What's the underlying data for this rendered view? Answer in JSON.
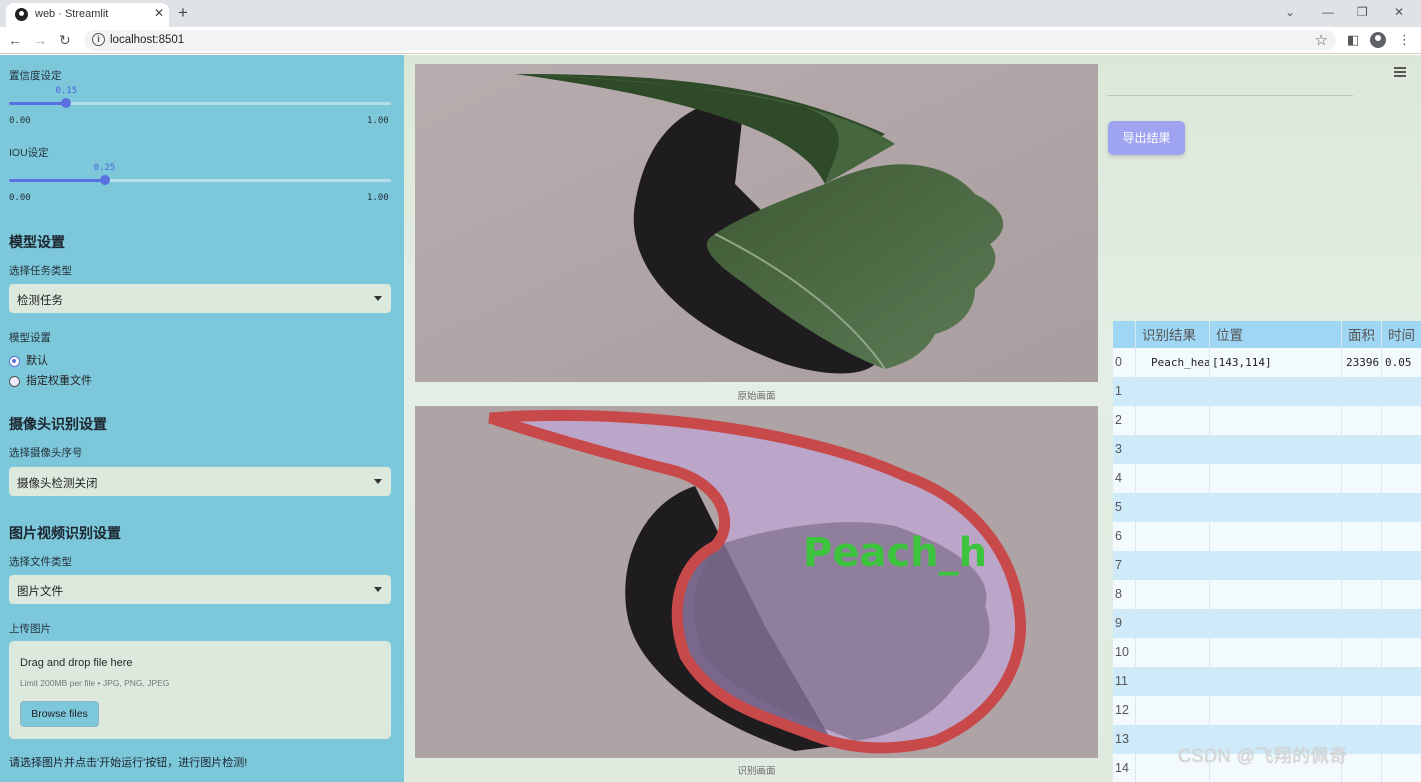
{
  "browser": {
    "tab_title": "web · Streamlit",
    "tab_close": "✕",
    "new_tab": "+",
    "url": "localhost:8501",
    "win_min": "⌄",
    "win_minimize": "—",
    "win_restore": "❐",
    "win_close": "✕"
  },
  "sidebar": {
    "conf_label": "置信度设定",
    "conf_value": "0.15",
    "conf_fraction": 0.15,
    "conf_min": "0.00",
    "conf_max": "1.00",
    "iou_label": "IOU设定",
    "iou_value": "0.25",
    "iou_fraction": 0.25,
    "iou_min": "0.00",
    "iou_max": "1.00",
    "model_heading": "模型设置",
    "task_type_label": "选择任务类型",
    "task_type_value": "检测任务",
    "model_setting_label": "模型设置",
    "radio_default": "默认",
    "radio_custom": "指定权重文件",
    "camera_heading": "摄像头识别设置",
    "camera_select_label": "选择摄像头序号",
    "camera_select_value": "摄像头检测关闭",
    "media_heading": "图片视频识别设置",
    "file_type_label": "选择文件类型",
    "file_type_value": "图片文件",
    "upload_label": "上传图片",
    "drop_title": "Drag and drop file here",
    "drop_sub": "Limit 200MB per file • JPG, PNG, JPEG",
    "browse_label": "Browse files",
    "bottom_hint": "请选择图片并点击'开始运行'按钮，进行图片检测!"
  },
  "main": {
    "caption_original": "原始画面",
    "caption_detected": "识别画面",
    "overlay_label": "Peach_h",
    "export_label": "导出结果",
    "table": {
      "headers": [
        "",
        "识别结果",
        "位置",
        "面积",
        "时间"
      ],
      "rows": [
        {
          "idx": "0",
          "result": "Peach_healthy",
          "pos": "[143,114]",
          "area": "23396",
          "time": "0.05"
        },
        {
          "idx": "1",
          "result": "",
          "pos": "",
          "area": "",
          "time": ""
        },
        {
          "idx": "2",
          "result": "",
          "pos": "",
          "area": "",
          "time": ""
        },
        {
          "idx": "3",
          "result": "",
          "pos": "",
          "area": "",
          "time": ""
        },
        {
          "idx": "4",
          "result": "",
          "pos": "",
          "area": "",
          "time": ""
        },
        {
          "idx": "5",
          "result": "",
          "pos": "",
          "area": "",
          "time": ""
        },
        {
          "idx": "6",
          "result": "",
          "pos": "",
          "area": "",
          "time": ""
        },
        {
          "idx": "7",
          "result": "",
          "pos": "",
          "area": "",
          "time": ""
        },
        {
          "idx": "8",
          "result": "",
          "pos": "",
          "area": "",
          "time": ""
        },
        {
          "idx": "9",
          "result": "",
          "pos": "",
          "area": "",
          "time": ""
        },
        {
          "idx": "10",
          "result": "",
          "pos": "",
          "area": "",
          "time": ""
        },
        {
          "idx": "11",
          "result": "",
          "pos": "",
          "area": "",
          "time": ""
        },
        {
          "idx": "12",
          "result": "",
          "pos": "",
          "area": "",
          "time": ""
        },
        {
          "idx": "13",
          "result": "",
          "pos": "",
          "area": "",
          "time": ""
        },
        {
          "idx": "14",
          "result": "",
          "pos": "",
          "area": "",
          "time": ""
        }
      ]
    }
  },
  "watermark": "CSDN @飞翔的佩奇",
  "colors": {
    "sidebar_bg": "#7dc7db",
    "accent": "#5c6fe0",
    "export_btn": "#9ea4ef",
    "mask_outline": "#c8494a",
    "mask_fill": "#c6a8e6",
    "label_green": "#3cc43c"
  }
}
